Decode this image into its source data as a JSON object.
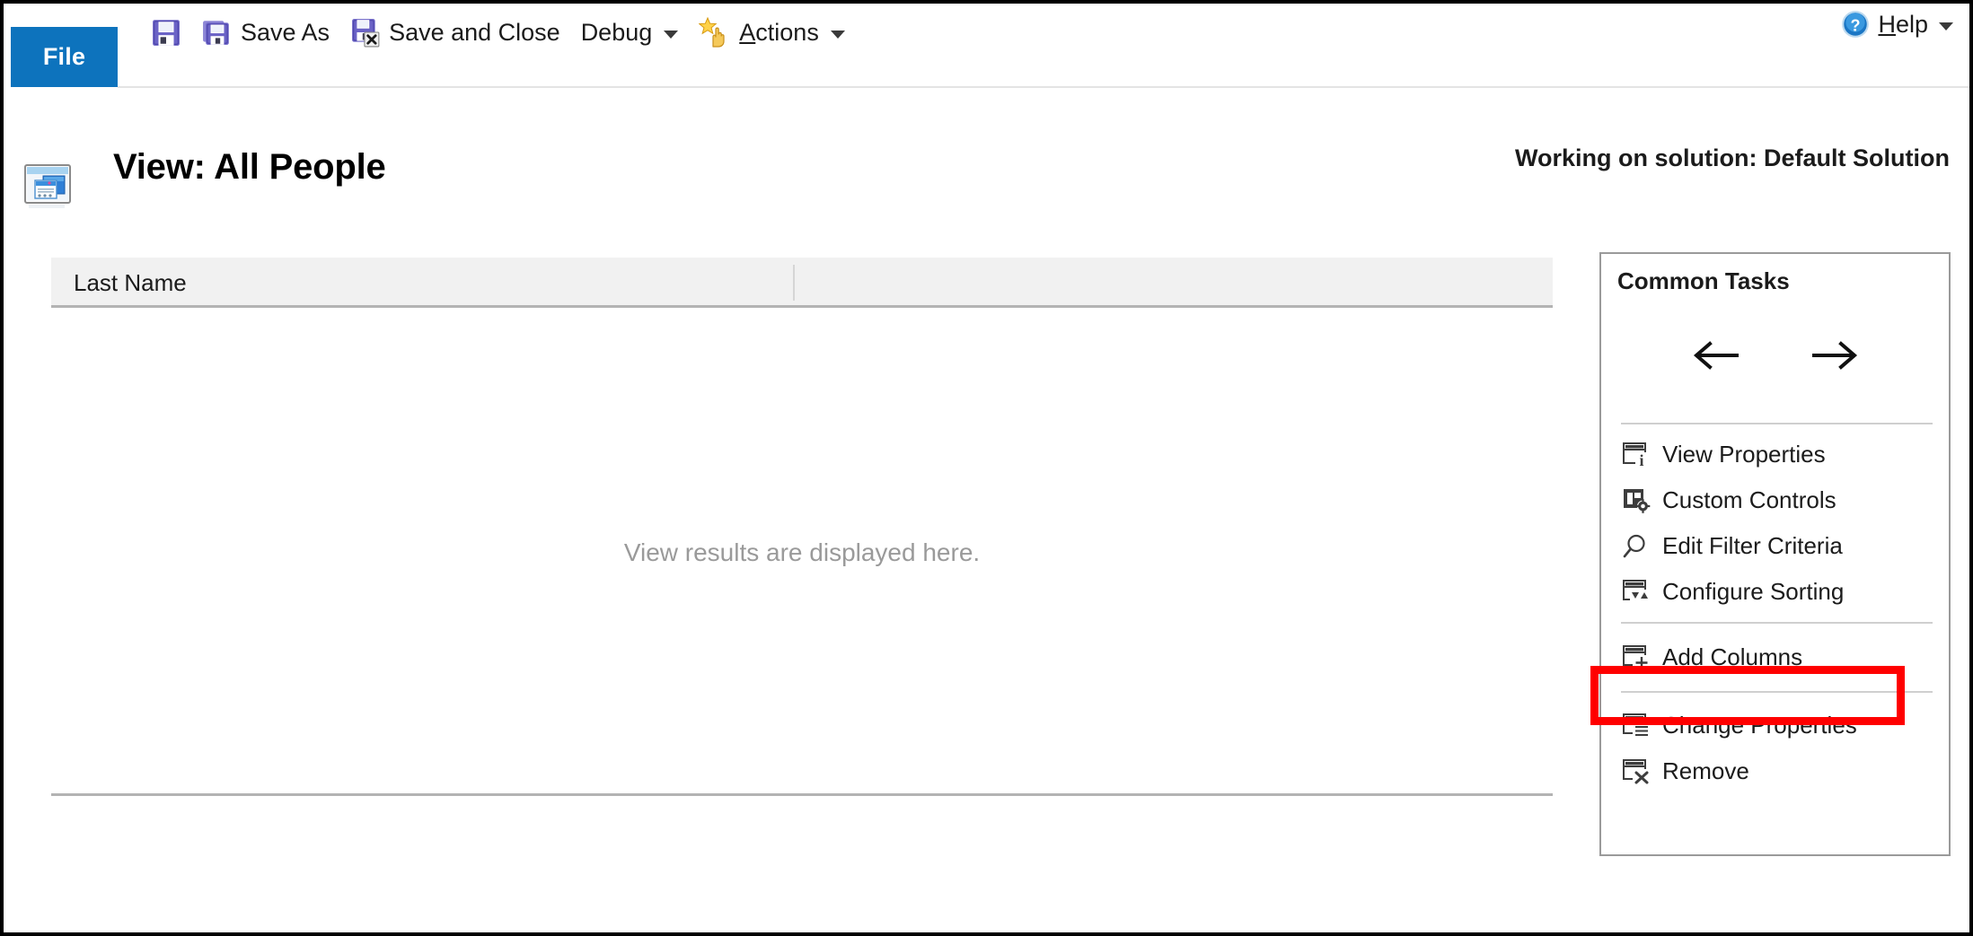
{
  "window": {
    "file_tab_label": "File"
  },
  "toolbar": {
    "items": [
      {
        "id": "save",
        "label": "",
        "icon": "floppy-save-icon",
        "has_caret": false
      },
      {
        "id": "save-as",
        "label": "Save As",
        "icon": "floppy-save-as-icon",
        "has_caret": false
      },
      {
        "id": "save-and-close",
        "label": "Save and Close",
        "icon": "floppy-save-close-icon",
        "has_caret": false
      },
      {
        "id": "debug",
        "label": "Debug",
        "icon": "",
        "has_caret": true
      },
      {
        "id": "actions",
        "label": "Actions",
        "accel": "A",
        "icon": "star-hand-actions-icon",
        "has_caret": true
      }
    ],
    "help": {
      "label": "Help",
      "accel": "H",
      "icon": "help-question-icon",
      "has_caret": true
    }
  },
  "header": {
    "icon": "view-window-icon",
    "title": "View: All People",
    "solution_note": "Working on solution: Default Solution"
  },
  "grid": {
    "columns": [
      {
        "label": "Last Name"
      },
      {
        "label": ""
      }
    ],
    "placeholder": "View results are displayed here.",
    "rows": []
  },
  "common_tasks": {
    "title": "Common Tasks",
    "nav": [
      {
        "id": "move-left",
        "icon": "arrow-left-icon"
      },
      {
        "id": "move-right",
        "icon": "arrow-right-icon"
      }
    ],
    "group_a": [
      {
        "id": "view-properties",
        "label": "View Properties",
        "icon": "view-properties-icon"
      },
      {
        "id": "custom-controls",
        "label": "Custom Controls",
        "icon": "custom-controls-icon"
      },
      {
        "id": "edit-filter-criteria",
        "label": "Edit Filter Criteria",
        "icon": "magnifier-icon"
      },
      {
        "id": "configure-sorting",
        "label": "Configure Sorting",
        "icon": "sort-icon"
      }
    ],
    "group_b": [
      {
        "id": "add-columns",
        "label": "Add Columns",
        "icon": "add-columns-icon",
        "highlighted": true
      }
    ],
    "group_c": [
      {
        "id": "change-properties",
        "label": "Change Properties",
        "icon": "change-properties-icon"
      },
      {
        "id": "remove",
        "label": "Remove",
        "icon": "remove-column-icon"
      }
    ]
  },
  "colors": {
    "file_tab_blue": "#0d73bd",
    "highlight_red": "#ff0000",
    "grid_header_gray": "#f1f1f1",
    "placeholder_gray": "#9a9a9a"
  }
}
